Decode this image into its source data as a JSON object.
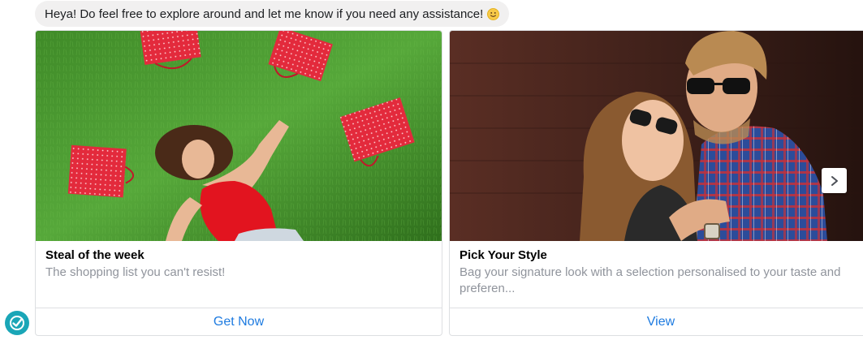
{
  "greeting": {
    "text": "Heya! Do feel free to explore around and let me know if you need any assistance!",
    "emoji_icon": "slightly-smiling-face-icon"
  },
  "avatar": {
    "icon": "checkmark-badge-icon",
    "color": "#1aa6b7"
  },
  "cards": [
    {
      "title": "Steal of the week",
      "subtitle": "The shopping list you can't resist!",
      "button_label": "Get Now",
      "image": "woman lying on grass with red polka-dot shopping bags"
    },
    {
      "title": "Pick Your Style",
      "subtitle": "Bag your signature look with a selection personalised to your taste and preferen...",
      "button_label": "View",
      "image": "couple wearing sunglasses"
    }
  ],
  "carousel": {
    "next_icon": "chevron-right-icon"
  },
  "colors": {
    "link": "#1e7be0",
    "bubble": "#f1f0f0",
    "subtitle": "#90949c"
  }
}
